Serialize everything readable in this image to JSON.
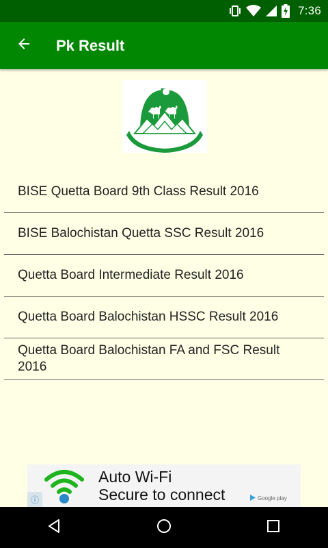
{
  "status_bar": {
    "time": "7:36"
  },
  "app_bar": {
    "title": "Pk Result"
  },
  "results": [
    {
      "label": "BISE Quetta Board 9th Class Result 2016"
    },
    {
      "label": "BISE Balochistan Quetta SSC Result 2016"
    },
    {
      "label": "Quetta Board Intermediate Result 2016"
    },
    {
      "label": "Quetta Board Balochistan HSSC Result 2016"
    },
    {
      "label": "Quetta Board Balochistan FA and FSC Result 2016"
    }
  ],
  "ad": {
    "title": "Auto Wi-Fi",
    "subtitle": "Secure to connect",
    "store_badge": "Google play"
  },
  "icons": {
    "vibrate": "vibrate-icon",
    "wifi": "wifi-icon",
    "signal": "signal-icon",
    "battery": "battery-charging-icon",
    "back_arrow": "arrow-left-icon",
    "nav_back": "nav-back-icon",
    "nav_home": "nav-home-icon",
    "nav_recents": "nav-recents-icon"
  },
  "colors": {
    "status_bar": "#005f00",
    "app_bar": "#028702",
    "background": "#ffffe6",
    "divider": "#666666",
    "logo_green": "#1a9a3a"
  }
}
